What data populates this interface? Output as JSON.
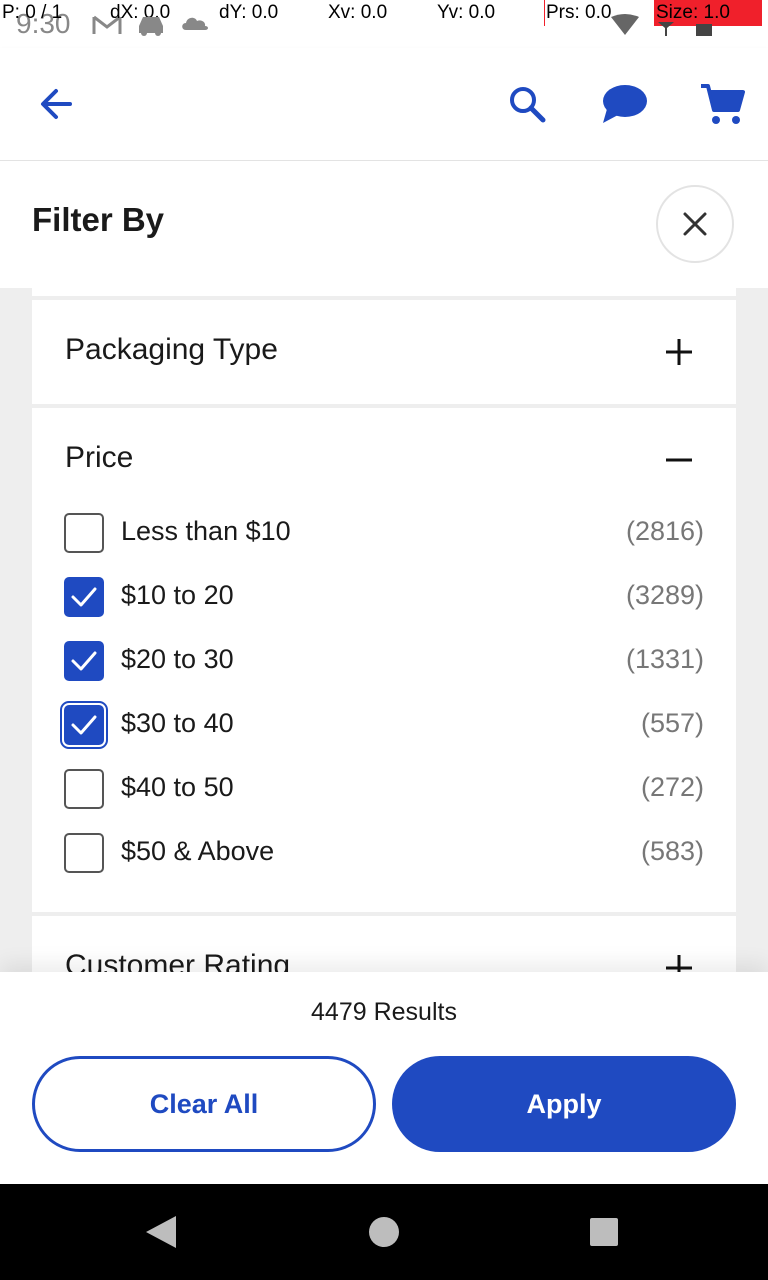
{
  "status_bar": {
    "time": "9:30",
    "p": "P: 0 / 1",
    "dx": "dX: 0.0",
    "dy": "dY: 0.0",
    "xv": "Xv: 0.0",
    "yv": "Yv: 0.0",
    "prs": "Prs: 0.0",
    "size": "Size: 1.0"
  },
  "colors": {
    "accent": "#1f4ac1",
    "panel_bg": "#eeeeee"
  },
  "app_bar": {
    "back_icon": "arrow-left-icon",
    "search_icon": "search-icon",
    "chat_icon": "chat-bubble-icon",
    "cart_icon": "cart-icon"
  },
  "filter": {
    "title": "Filter By",
    "close_icon": "close-icon",
    "sections": {
      "packaging": {
        "title": "Packaging Type",
        "expanded": false,
        "icon": "plus-icon"
      },
      "price": {
        "title": "Price",
        "expanded": true,
        "icon": "minus-icon",
        "options": [
          {
            "label": "Less than $10",
            "count": "(2816)",
            "checked": false
          },
          {
            "label": "$10 to 20",
            "count": "(3289)",
            "checked": true
          },
          {
            "label": "$20 to 30",
            "count": "(1331)",
            "checked": true
          },
          {
            "label": "$30 to 40",
            "count": "(557)",
            "checked": true
          },
          {
            "label": "$40 to 50",
            "count": "(272)",
            "checked": false
          },
          {
            "label": "$50 & Above",
            "count": "(583)",
            "checked": false
          }
        ]
      },
      "rating": {
        "title": "Customer Rating",
        "expanded": false,
        "icon": "plus-icon"
      }
    }
  },
  "footer": {
    "results": "4479 Results",
    "clear_label": "Clear All",
    "apply_label": "Apply"
  },
  "nav_bar": {
    "back_icon": "nav-back-icon",
    "home_icon": "nav-home-icon",
    "recents_icon": "nav-recents-icon"
  }
}
